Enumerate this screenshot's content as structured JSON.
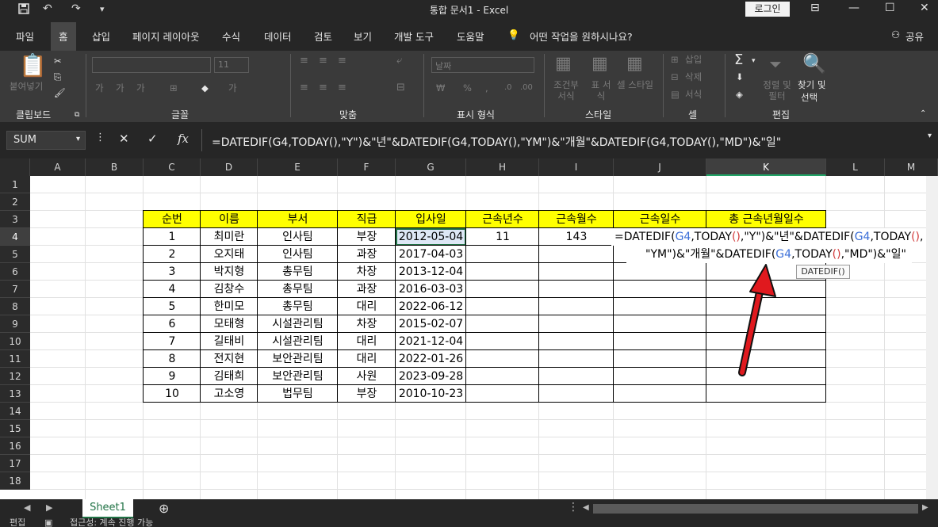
{
  "titlebar": {
    "title": "통합 문서1  -  Excel",
    "login_label": "로그인"
  },
  "menu": {
    "tabs": [
      "파일",
      "홈",
      "삽입",
      "페이지 레이아웃",
      "수식",
      "데이터",
      "검토",
      "보기",
      "개발 도구",
      "도움말"
    ],
    "active_tab": "홈",
    "tell_me": "어떤 작업을 원하시나요?",
    "share": "공유"
  },
  "ribbon": {
    "groups": [
      "클립보드",
      "글꼴",
      "맞춤",
      "표시 형식",
      "스타일",
      "셀",
      "편집"
    ],
    "paste_label": "붙여넣기",
    "font_size": "11",
    "number_format": "날짜",
    "conditional_format": "조건부 서식",
    "table_format": "표 서식",
    "cell_style": "셀 스타일",
    "insert": "삽입",
    "delete": "삭제",
    "format": "서식",
    "sort_filter": "정렬 및 필터",
    "find_select_1": "찾기 및",
    "find_select_2": "선택"
  },
  "formula_bar": {
    "name_box": "SUM",
    "formula": "=DATEDIF(G4,TODAY(),\"Y\")&\"년\"&DATEDIF(G4,TODAY(),\"YM\")&\"개월\"&DATEDIF(G4,TODAY(),\"MD\")&\"일\""
  },
  "sheet": {
    "columns": [
      "A",
      "B",
      "C",
      "D",
      "E",
      "F",
      "G",
      "H",
      "I",
      "J",
      "K",
      "L",
      "M"
    ],
    "rows": [
      "1",
      "2",
      "3",
      "4",
      "5",
      "6",
      "7",
      "8",
      "9",
      "10",
      "11",
      "12",
      "13",
      "14",
      "15",
      "16",
      "17",
      "18"
    ],
    "headers": [
      "순번",
      "이름",
      "부서",
      "직급",
      "입사일",
      "근속년수",
      "근속월수",
      "근속일수",
      "총 근속년월일수"
    ],
    "data": [
      [
        "1",
        "최미란",
        "인사팀",
        "부장",
        "2012-05-04",
        "11",
        "143"
      ],
      [
        "2",
        "오지태",
        "인사팀",
        "과장",
        "2017-04-03",
        "",
        ""
      ],
      [
        "3",
        "박지형",
        "총무팀",
        "차장",
        "2013-12-04",
        "",
        ""
      ],
      [
        "4",
        "김창수",
        "총무팀",
        "과장",
        "2016-03-03",
        "",
        ""
      ],
      [
        "5",
        "한미모",
        "총무팀",
        "대리",
        "2022-06-12",
        "",
        ""
      ],
      [
        "6",
        "모태형",
        "시설관리팀",
        "차장",
        "2015-02-07",
        "",
        ""
      ],
      [
        "7",
        "길태비",
        "시설관리팀",
        "대리",
        "2021-12-04",
        "",
        ""
      ],
      [
        "8",
        "전지현",
        "보안관리팀",
        "대리",
        "2022-01-26",
        "",
        ""
      ],
      [
        "9",
        "김태희",
        "보안관리팀",
        "사원",
        "2023-09-28",
        "",
        ""
      ],
      [
        "10",
        "고소영",
        "법무팀",
        "부장",
        "2010-10-23",
        "",
        ""
      ]
    ],
    "edit_line1": {
      "p1": "=DATEDIF(",
      "p2": "G4",
      "p3": ",TODAY",
      "p4": "()",
      "p5": ",\"Y\")&\"년\"&DATEDIF(",
      "p6": "G4",
      "p7": ",TODAY",
      "p8": "()",
      "p9": ","
    },
    "edit_line2": {
      "p1": "\"YM\")&\"개월\"&DATEDIF(",
      "p2": "G4",
      "p3": ",TODAY",
      "p4": "()",
      "p5": ",\"MD\")&\"일\""
    },
    "tooltip": "DATEDIF()"
  },
  "sheet_tabs": {
    "active": "Sheet1"
  },
  "status": {
    "mode": "편집",
    "accessibility": "접근성: 계속 진행 가능"
  },
  "colors": {
    "annotation_arrow": "#e0191e",
    "header_fill": "#ffff00",
    "reference_blue": "#3b6fd8",
    "paren_red": "#d23c3c"
  }
}
